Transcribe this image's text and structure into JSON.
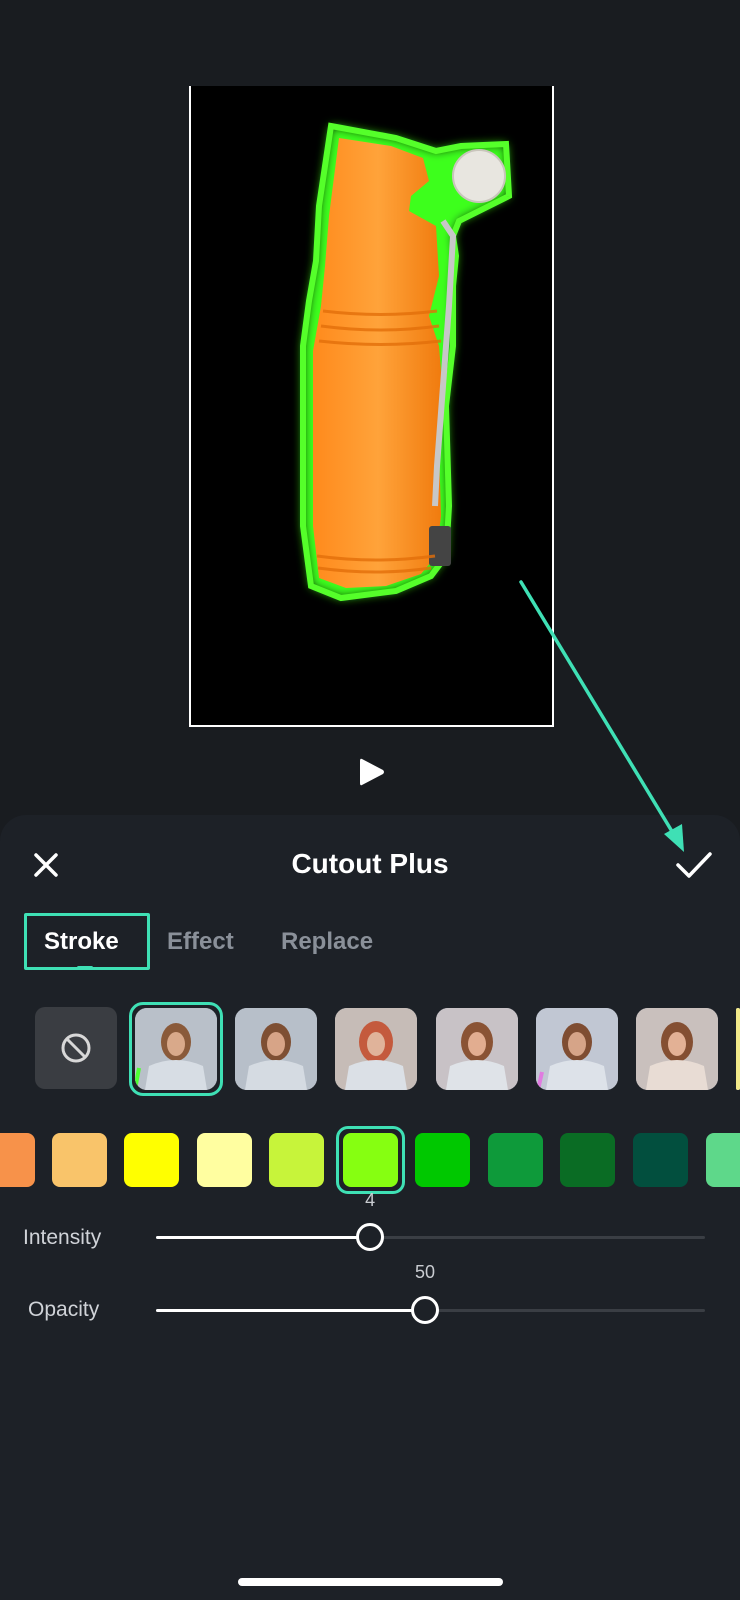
{
  "header": {
    "title": "Cutout Plus"
  },
  "tabs": [
    {
      "label": "Stroke",
      "active": true
    },
    {
      "label": "Effect",
      "active": false
    },
    {
      "label": "Replace",
      "active": false
    }
  ],
  "icons": {
    "close": "close-icon",
    "confirm": "checkmark-icon",
    "play": "play-icon",
    "none": "none-icon"
  },
  "style_presets": {
    "selected_index": 1,
    "count": 7
  },
  "colors": {
    "accent": "#3fe0b5",
    "swatches": [
      "#f7924a",
      "#f9c46a",
      "#ffff00",
      "#fffea0",
      "#c7f43a",
      "#86ff11",
      "#00c800",
      "#0e9a3a",
      "#0a6c24",
      "#024f3e",
      "#5ed88a"
    ],
    "selected_swatch_index": 5
  },
  "sliders": {
    "intensity": {
      "label": "Intensity",
      "value": "4",
      "fraction": 0.39
    },
    "opacity": {
      "label": "Opacity",
      "value": "50",
      "fraction": 0.49
    }
  }
}
